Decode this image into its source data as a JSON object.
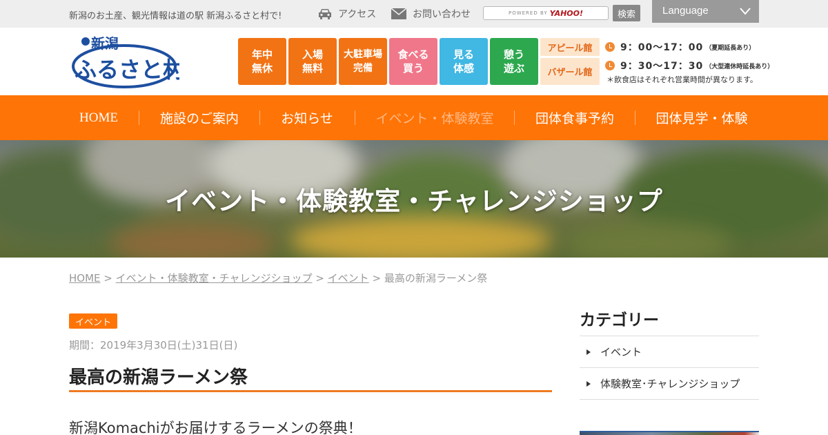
{
  "topbar": {
    "tagline": "新潟のお土産、観光情報は道の駅 新潟ふるさと村で!",
    "access_label": "アクセス",
    "contact_label": "お問い合わせ",
    "search_powered": "POWERED BY",
    "search_brand": "YAHOO!",
    "search_button": "検索",
    "language_label": "Language"
  },
  "logo": {
    "line1": "新潟",
    "line2": "ふるさと村"
  },
  "tiles": [
    {
      "line1": "年中",
      "line2": "無休"
    },
    {
      "line1": "入場",
      "line2": "無料"
    },
    {
      "line1": "大駐車場",
      "line2": "完備"
    },
    {
      "line1": "食べる",
      "line2": "買う"
    },
    {
      "line1": "見る",
      "line2": "体感"
    },
    {
      "line1": "憩う",
      "line2": "遊ぶ"
    }
  ],
  "halls": {
    "appeal": "アピール館",
    "bazaar": "バザール館",
    "appeal_hours": "9：00〜17：00",
    "appeal_note": "（夏期延長あり）",
    "bazaar_hours": "9：30〜17：30",
    "bazaar_note": "（大型連休時延長あり）",
    "notice": "＊飲食店はそれぞれ営業時間が異なります。"
  },
  "nav": {
    "items": [
      "HOME",
      "施設のご案内",
      "お知らせ",
      "イベント・体験教室",
      "団体食事予約",
      "団体見学・体験"
    ],
    "active_index": 3
  },
  "hero": {
    "title": "イベント・体験教室・チャレンジショップ"
  },
  "breadcrumb": {
    "home": "HOME",
    "sep": ">",
    "level1": "イベント・体験教室・チャレンジショップ",
    "level2": "イベント",
    "current": "最高の新潟ラーメン祭"
  },
  "post": {
    "category_badge": "イベント",
    "period": "期間：2019年3月30日(土)31日(日)",
    "title": "最高の新潟ラーメン祭",
    "lead": "新潟Komachiがお届けするラーメンの祭典！"
  },
  "sidebar": {
    "heading": "カテゴリー",
    "categories": [
      "イベント",
      "体験教室･チャレンジショップ"
    ]
  },
  "colors": {
    "brand_orange": "#ff7406",
    "tile_orange": "#f27314",
    "tile_pink": "#f0778a",
    "tile_blue": "#41b7e3",
    "tile_green": "#2da84f",
    "logo_blue": "#1d4fa0"
  },
  "icons": {
    "access": "car-icon",
    "contact": "mail-icon",
    "language": "chevron-down-icon",
    "hours": "clock-icon",
    "category": "triangle-right-icon"
  }
}
